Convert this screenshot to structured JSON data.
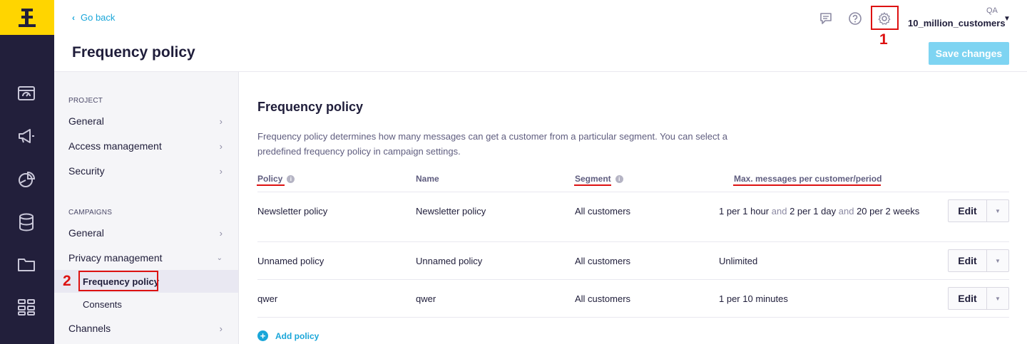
{
  "header": {
    "back_label": "Go back",
    "page_title": "Frequency policy",
    "account_env": "QA",
    "account_name": "10_million_customers",
    "save_label": "Save changes"
  },
  "annotations": {
    "one": "1",
    "two": "2"
  },
  "icons": {
    "logo": "exponea-logo",
    "rail": [
      "dashboard-icon",
      "megaphone-icon",
      "pie-chart-icon",
      "database-icon",
      "folder-icon",
      "apps-grid-icon"
    ],
    "top": [
      "chat-icon",
      "help-icon",
      "gear-icon"
    ]
  },
  "colors": {
    "accent": "#1aa6d9",
    "rail_bg": "#221f3b",
    "logo_bg": "#ffd500",
    "annotation": "#dd1111"
  },
  "sidebar": {
    "project_heading": "PROJECT",
    "project_items": [
      {
        "label": "General"
      },
      {
        "label": "Access management"
      },
      {
        "label": "Security"
      }
    ],
    "campaigns_heading": "CAMPAIGNS",
    "campaign_items": [
      {
        "label": "General"
      },
      {
        "label": "Privacy management"
      }
    ],
    "privacy_sub": [
      {
        "label": "Frequency policy"
      },
      {
        "label": "Consents"
      }
    ],
    "channels_label": "Channels"
  },
  "main": {
    "title": "Frequency policy",
    "description": "Frequency policy determines how many messages can get a customer from a particular segment. You can select a predefined frequency policy in campaign settings.",
    "columns": [
      "Policy",
      "Name",
      "Segment",
      "Max. messages per customer/period"
    ],
    "rows": [
      {
        "policy": "Newsletter policy",
        "name": "Newsletter policy",
        "segment": "All customers",
        "max_parts": [
          "1 per 1 hour",
          "and",
          "2 per 1 day",
          "and",
          "20 per 2 weeks"
        ],
        "edit": "Edit"
      },
      {
        "policy": "Unnamed policy",
        "name": "Unnamed policy",
        "segment": "All customers",
        "max": "Unlimited",
        "edit": "Edit"
      },
      {
        "policy": "qwer",
        "name": "qwer",
        "segment": "All customers",
        "max": "1 per 10 minutes",
        "edit": "Edit"
      }
    ],
    "add_policy_label": "Add policy"
  }
}
